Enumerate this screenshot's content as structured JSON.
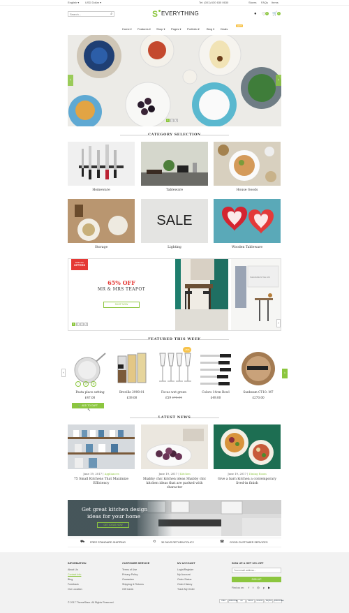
{
  "topbar": {
    "language": "English",
    "currency": "USD Dollar",
    "phone": "Tel: (001) 630 630 0630",
    "links": [
      "Stores",
      "FAQs",
      "Items"
    ]
  },
  "header": {
    "search_placeholder": "Search...",
    "logo_text": "EVERYTHING",
    "logo_mark": "S",
    "wishlist_count": "0",
    "cart_count": "0"
  },
  "nav": {
    "items": [
      "Home",
      "Features",
      "Shop",
      "Pages",
      "Portfolio",
      "Blog",
      "Deals"
    ],
    "badge": "HOT"
  },
  "hero": {
    "dots": [
      "1",
      "2",
      "3"
    ]
  },
  "categories": {
    "title": "CATEGORY SELECTION",
    "items": [
      "Homeware",
      "Tableware",
      "House Goods",
      "Storage",
      "Lighting",
      "Wooden Tableware"
    ],
    "sale_text": "SALE"
  },
  "promo": {
    "ribbon_line1": "SPECIAL",
    "ribbon_line2": "OFFERS",
    "discount": "65% OFF",
    "product": "MR & MRS TEAPOT",
    "button": "SHOP NOW",
    "dots": [
      "1",
      "2",
      "3",
      "4"
    ],
    "side_caption": "PLEASURE IN THE LOS"
  },
  "featured": {
    "title": "FEATURED THIS WEEK",
    "badge": "-25%",
    "add_to_cart": "ADD TO CART",
    "products": [
      {
        "name": "Pasta place setting",
        "price": "£47.00",
        "old": ""
      },
      {
        "name": "Breville 2990-01",
        "price": "£39.00",
        "old": ""
      },
      {
        "name": "Focus wet green",
        "price": "£59",
        "old": "£78.00"
      },
      {
        "name": "Colors 14cm Bowl",
        "price": "£49.00",
        "old": ""
      },
      {
        "name": "Sunbeam CT10: M7",
        "price": "£270.00",
        "old": ""
      }
    ]
  },
  "news": {
    "title": "LATEST NEWS",
    "items": [
      {
        "date": "June 19, 2017",
        "cat": "Appliances",
        "title": "75 Small Kitchens That Maximize Efficiency"
      },
      {
        "date": "June 19, 2017",
        "cat": "Kitchen",
        "title": "Shabby chic kitchen ideas Shabby chic kitchen ideas that are packed with character"
      },
      {
        "date": "June 19, 2017",
        "cat": "Dining Room",
        "title": "Give a barn kitchen a contemporary lived-in finish"
      }
    ]
  },
  "banner": {
    "line1": "Get great kitchen design",
    "line2": "ideas for your home",
    "button": "GET IDEAS NOW"
  },
  "features": [
    "FREE STANDARD SHIPPING",
    "30 DAYS RETURN POLICY",
    "GOOD CUSTOMER SERVICES"
  ],
  "footer": {
    "cols": [
      {
        "title": "INFORMATION",
        "items": [
          "About Us",
          "Contact Info",
          "Blog",
          "Feedback",
          "Our Location"
        ]
      },
      {
        "title": "CUSTOMER SERVICE",
        "items": [
          "Terms of Use",
          "Privacy Policy",
          "Guarantee",
          "Shipping & Returns",
          "Gift Cards"
        ]
      },
      {
        "title": "MY ACCOUNT",
        "items": [
          "Login/Register",
          "My Account",
          "Order Status",
          "Order History",
          "Track My Order"
        ]
      }
    ],
    "signup_title": "SIGN UP & GET 10% OFF",
    "email_placeholder": "Your email address...",
    "signup_button": "SIGN UP",
    "find_us": "Find us on:",
    "copyright": "© 2017 ThemeStarz. All Rights Reserved.",
    "payments": [
      "VISA",
      "DISCOVER",
      "citi",
      "bitcoin",
      "amazon",
      "PayPal",
      "DISCOVER"
    ]
  },
  "colors": {
    "accent": "#8cc63f",
    "badge": "#f7c34b",
    "promo_red": "#e53935"
  }
}
